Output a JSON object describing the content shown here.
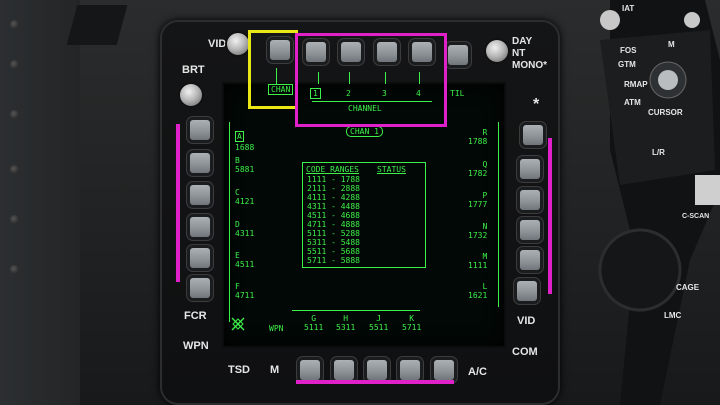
{
  "bezel": {
    "top_left": "VID",
    "top_right": [
      "DAY",
      "NT",
      "MONO*"
    ],
    "left_top": "BRT",
    "fcr": "FCR",
    "wpn": "WPN",
    "tsd": "TSD",
    "m": "M",
    "ac": "A/C",
    "vid": "VID",
    "com": "COM",
    "star": "*"
  },
  "mfd": {
    "chan_tab": "CHAN",
    "channels": [
      "1",
      "2",
      "3",
      "4"
    ],
    "channel_label": "CHANNEL",
    "util_label": "TIL",
    "page_title": "CHAN 1",
    "left_codes": [
      {
        "letter": "A",
        "code": "1688"
      },
      {
        "letter": "B",
        "code": "5881"
      },
      {
        "letter": "C",
        "code": "4121"
      },
      {
        "letter": "D",
        "code": "4311"
      },
      {
        "letter": "E",
        "code": "4511"
      },
      {
        "letter": "F",
        "code": "4711"
      }
    ],
    "right_codes": [
      {
        "letter": "R",
        "code": "1788"
      },
      {
        "letter": "Q",
        "code": "1782"
      },
      {
        "letter": "P",
        "code": "1777"
      },
      {
        "letter": "N",
        "code": "1732"
      },
      {
        "letter": "M",
        "code": "1111"
      },
      {
        "letter": "L",
        "code": "1621"
      }
    ],
    "bottom_codes": [
      {
        "letter": "G",
        "code": "5111"
      },
      {
        "letter": "H",
        "code": "5311"
      },
      {
        "letter": "J",
        "code": "5511"
      },
      {
        "letter": "K",
        "code": "5711"
      }
    ],
    "bottom_wpn": "WPN",
    "table_header": [
      "CODE RANGES",
      "STATUS"
    ],
    "code_ranges": [
      "1111 - 1788",
      "2111 - 2888",
      "4111 - 4288",
      "4311 - 4488",
      "4511 - 4688",
      "4711 - 4888",
      "5111 - 5288",
      "5311 - 5488",
      "5511 - 5688",
      "5711 - 5888"
    ]
  },
  "grip": {
    "labels": [
      "IAT",
      "M",
      "FOS",
      "GTM",
      "RMAP",
      "ATM",
      "CURSOR",
      "L/R",
      "C-SCAN",
      "CAGE",
      "LMC"
    ]
  },
  "colors": {
    "mfd_green": "#3df04a",
    "highlight_magenta": "#e020c8",
    "highlight_yellow": "#e8e814"
  }
}
